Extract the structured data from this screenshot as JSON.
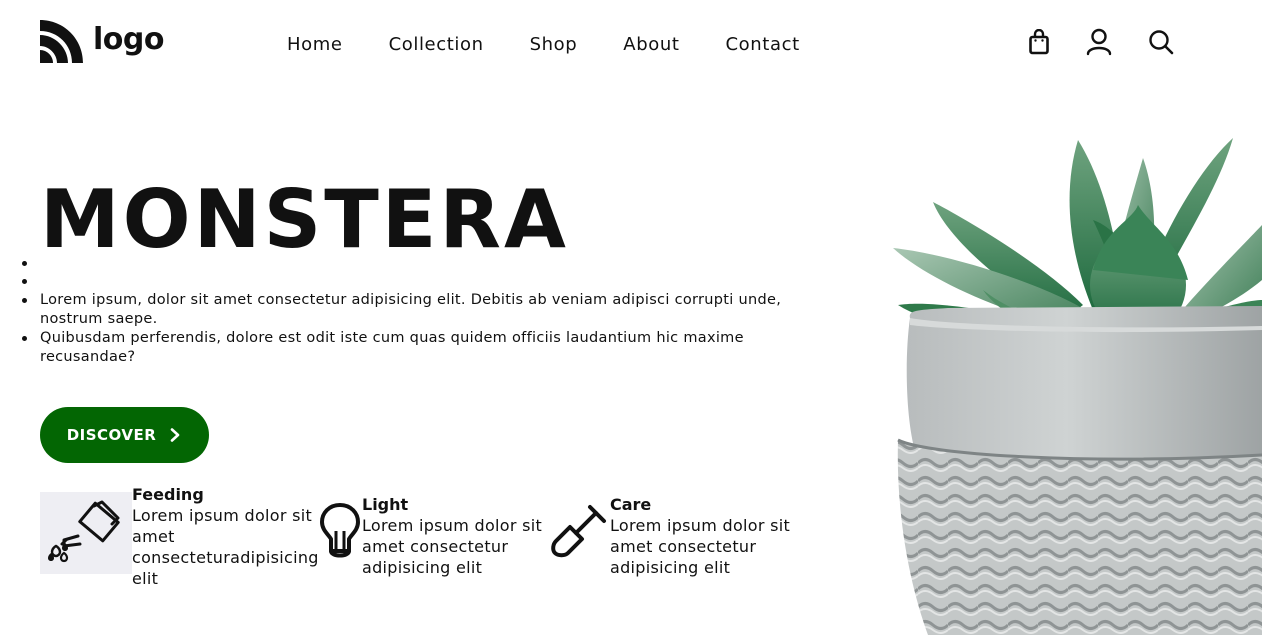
{
  "header": {
    "logo_text": "logo",
    "nav": [
      "Home",
      "Collection",
      "Shop",
      "About",
      "Contact"
    ],
    "icons": [
      "shopping-bag-icon",
      "user-icon",
      "search-icon"
    ]
  },
  "hero": {
    "title": "MONSTERA",
    "bullets": [
      "",
      "",
      "Lorem ipsum, dolor sit amet consectetur adipisicing elit. Debitis ab veniam adipisci corrupti unde, nostrum saepe.",
      "Quibusdam perferendis, dolore est odit iste cum quas quidem officiis laudantium hic maxime recusandae?"
    ],
    "cta_label": "DISCOVER"
  },
  "features": [
    {
      "title": "Feeding",
      "text": "Lorem ipsum dolor sit amet consecteturadipisicing elit",
      "icon": "watering-can-icon"
    },
    {
      "title": "Light",
      "text": "Lorem ipsum dolor sit amet consectetur adipisicing elit",
      "icon": "light-bulb-icon"
    },
    {
      "title": "Care",
      "text": "Lorem ipsum dolor sit amet consectetur adipisicing elit",
      "icon": "shovel-icon"
    }
  ],
  "colors": {
    "accent": "#036603",
    "text": "#111111",
    "background": "#ffffff"
  }
}
